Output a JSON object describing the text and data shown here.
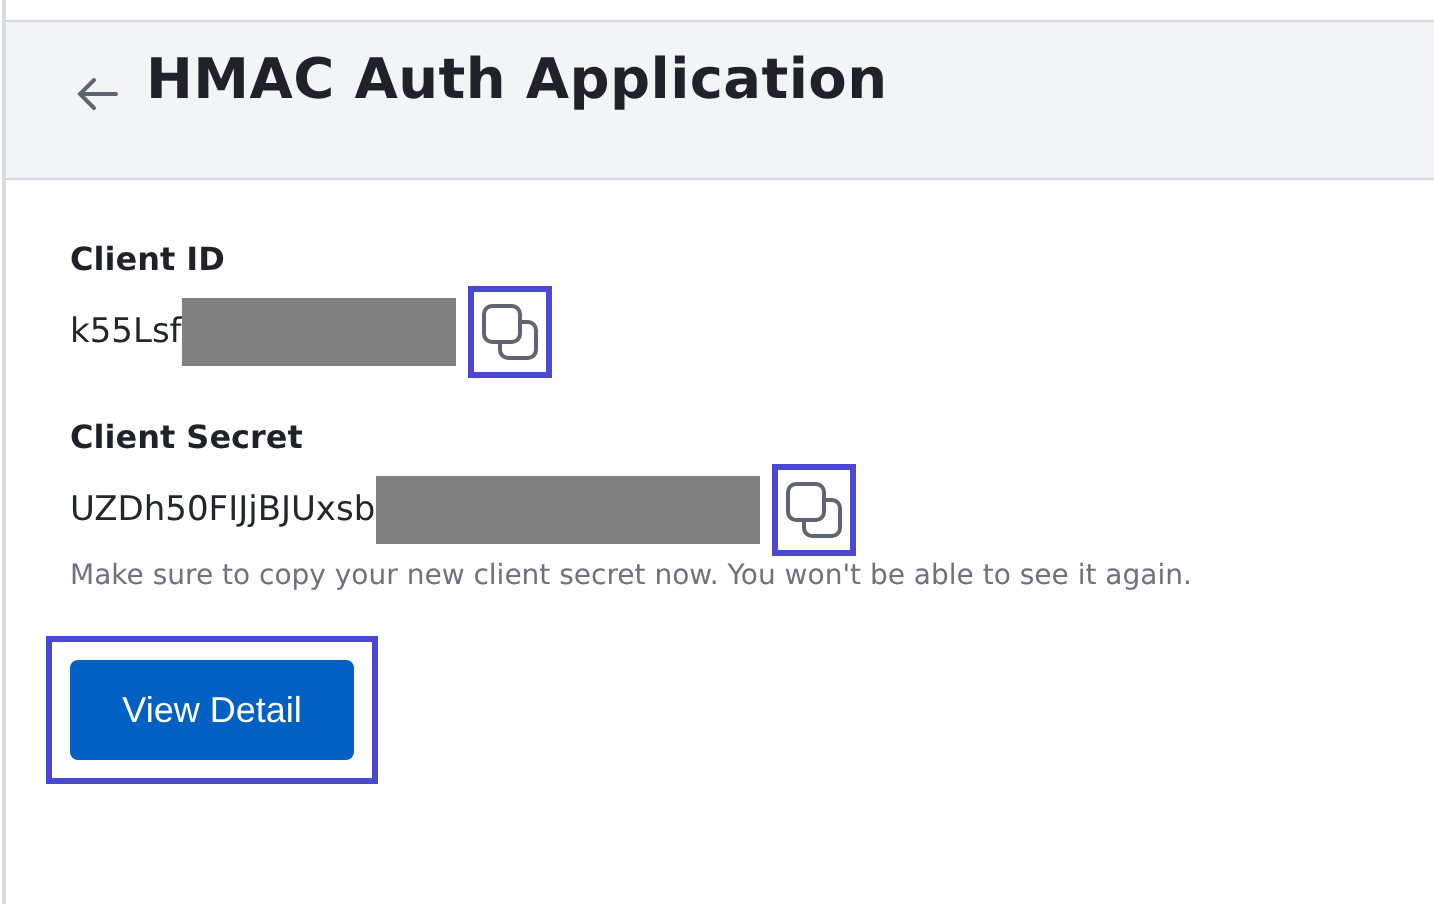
{
  "header": {
    "title": "HMAC Auth Application"
  },
  "fields": [
    {
      "label": "Client ID",
      "value": "k55Lsf",
      "redacted": true,
      "copy_highlighted": true
    },
    {
      "label": "Client Secret",
      "value": "UZDh50FIJjBJUxsb",
      "redacted": true,
      "copy_highlighted": true,
      "hint": "Make sure to copy your new client secret now. You won't be able to see it again."
    }
  ],
  "action": {
    "label": "View Detail",
    "highlighted": true
  }
}
